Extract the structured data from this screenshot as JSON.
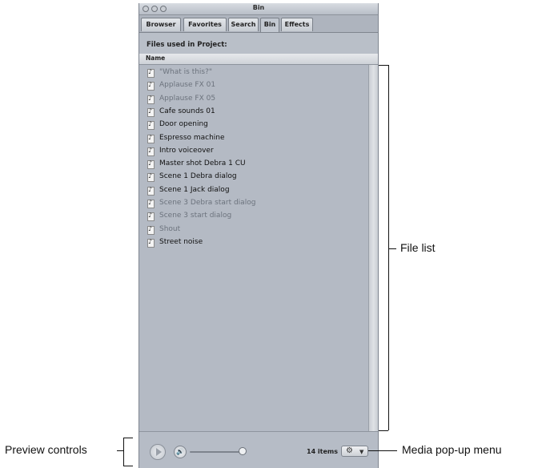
{
  "window": {
    "title": "Bin",
    "tabs": [
      {
        "label": "Browser",
        "active": false
      },
      {
        "label": "Favorites",
        "active": false
      },
      {
        "label": "Search",
        "active": false
      },
      {
        "label": "Bin",
        "active": true
      },
      {
        "label": "Effects",
        "active": false
      }
    ],
    "subheader": "Files used in Project:",
    "column_header": "Name",
    "files": [
      {
        "label": "\"What is this?\"",
        "dimmed": true
      },
      {
        "label": "Applause FX 01",
        "dimmed": true
      },
      {
        "label": "Applause FX 05",
        "dimmed": true
      },
      {
        "label": "Cafe sounds 01",
        "dimmed": false
      },
      {
        "label": "Door opening",
        "dimmed": false
      },
      {
        "label": "Espresso machine",
        "dimmed": false
      },
      {
        "label": "Intro voiceover",
        "dimmed": false
      },
      {
        "label": "Master shot Debra 1 CU",
        "dimmed": false
      },
      {
        "label": "Scene 1 Debra dialog",
        "dimmed": false
      },
      {
        "label": "Scene 1 Jack dialog",
        "dimmed": false
      },
      {
        "label": "Scene 3 Debra start dialog",
        "dimmed": true
      },
      {
        "label": "Scene 3 start dialog",
        "dimmed": true
      },
      {
        "label": "Shout",
        "dimmed": true
      },
      {
        "label": "Street noise",
        "dimmed": false
      }
    ],
    "file_icon": "audio-file-icon",
    "items_count": "14 items",
    "volume_level": 0.95
  },
  "callouts": {
    "file_list": "File list",
    "preview_controls": "Preview controls",
    "media_popup": "Media pop-up menu"
  },
  "colors": {
    "window_bg": "#b6bcc6",
    "dimmed_text": "#6c737d",
    "normal_text": "#111111"
  }
}
